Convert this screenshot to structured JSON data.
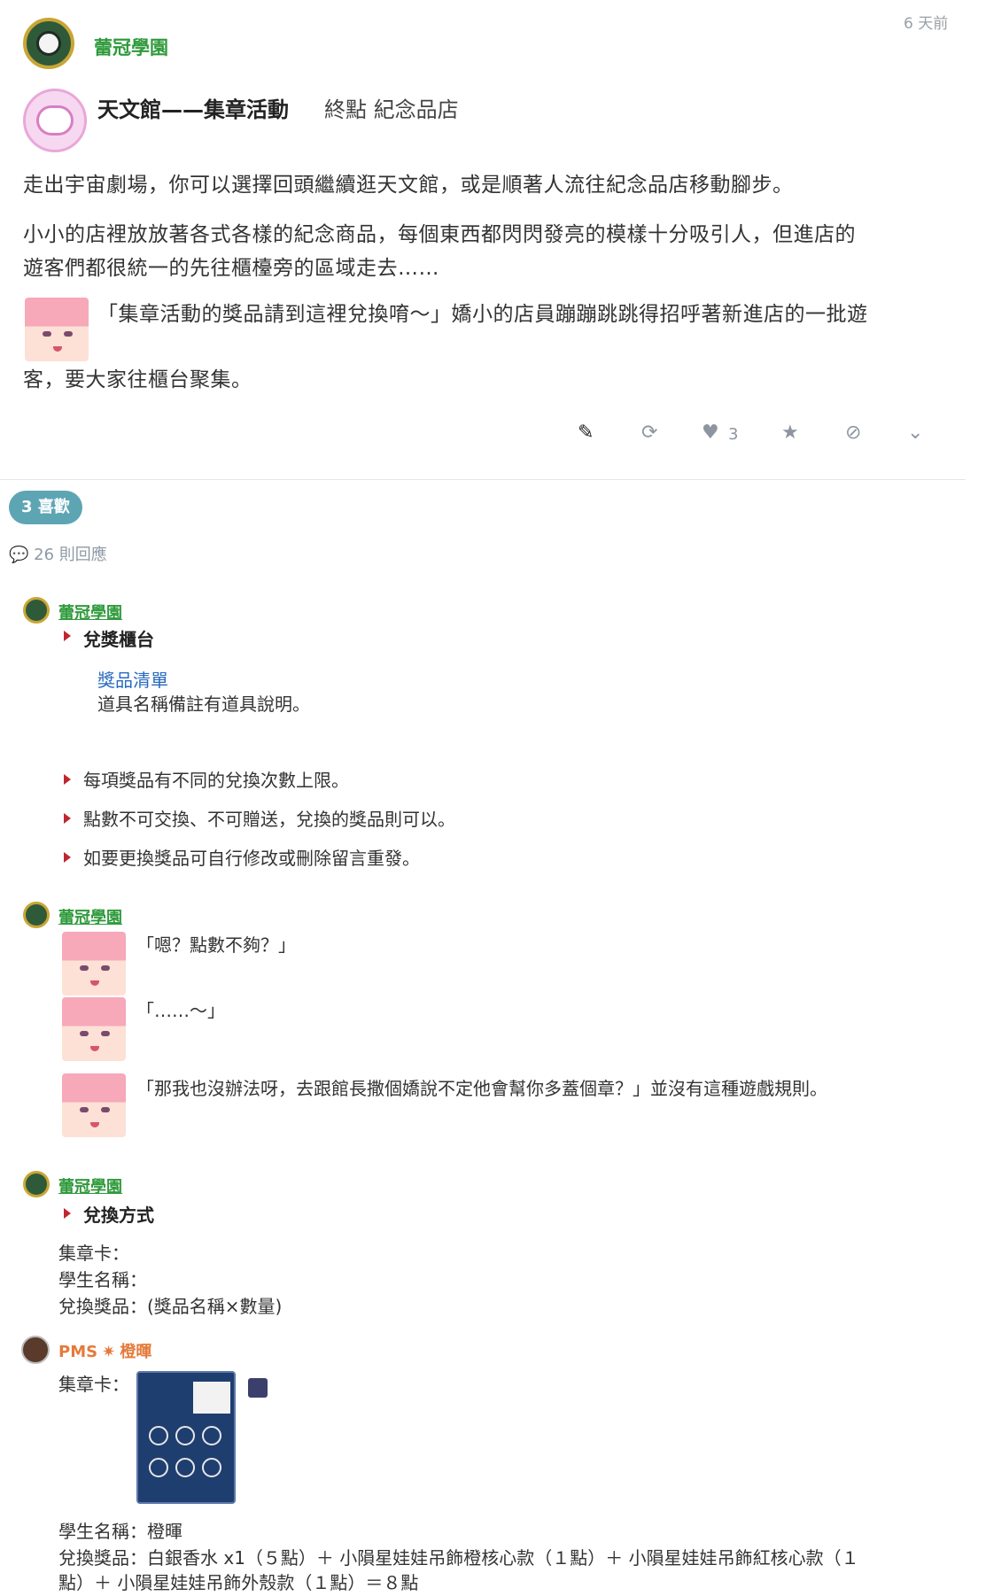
{
  "post": {
    "author": "蕾冠學園",
    "time": "6 天前",
    "title_main": "天文館——集章活動",
    "title_sub": "終點 紀念品店",
    "p1": "走出宇宙劇場，你可以選擇回頭繼續逛天文館，或是順著人流往紀念品店移動腳步。",
    "p2_line1": "小小的店裡放放著各式各樣的紀念商品，每個東西都閃閃發亮的模樣十分吸引人，但進店的",
    "p2_line2": "遊客們都很統一的先往櫃檯旁的區域走去……",
    "p3_line1": "「集章活動的獎品請到這裡兌換唷～」嬌小的店員蹦蹦跳跳得招呼著新進店的一批遊",
    "p3_line2": "客，要大家往櫃台聚集。"
  },
  "actions": {
    "like_count": "3",
    "icons": [
      "mute-icon",
      "refresh-icon",
      "heart-icon",
      "star-icon",
      "flag-icon",
      "chevron-down-icon"
    ]
  },
  "summary": {
    "likes_pill": "3 喜歡",
    "replies": "26 則回應"
  },
  "quote1": {
    "author": "蕾冠學園",
    "section_title": "兌獎櫃台",
    "link": "獎品清單",
    "note": "道具名稱備註有道具說明。",
    "bullets": [
      "每項獎品有不同的兌換次數上限。",
      "點數不可交換、不可贈送，兌換的獎品則可以。",
      "如要更換獎品可自行修改或刪除留言重發。"
    ]
  },
  "quote2": {
    "author": "蕾冠學園",
    "line1": "「嗯？點數不夠？」",
    "line2": "「……～」",
    "line3": "「那我也沒辦法呀，去跟館長撒個嬌說不定他會幫你多蓋個章？」並沒有這種遊戲規則。"
  },
  "quote3": {
    "author": "蕾冠學園",
    "section_title": "兌換方式",
    "l1": "集章卡：",
    "l2": "學生名稱：",
    "l3": "兌換獎品：(獎品名稱×數量)"
  },
  "reply": {
    "author": "PMS",
    "star": "✷",
    "name": "橙暉",
    "card_label": "集章卡：",
    "student": "學生名稱：橙暉",
    "prize_line1": "兌換獎品：白銀香水 x1（５點）＋ 小隕星娃娃吊飾橙核心款（１點）＋ 小隕星娃娃吊飾紅核心款（１",
    "prize_line2": "點）＋ 小隕星娃娃吊飾外殼款（１點）＝８點"
  },
  "colors": {
    "accent_green": "#2f9a3c",
    "likes_pill": "#5ea5b4",
    "bullet_red": "#c02631",
    "link_blue": "#2a6bbf",
    "pms_orange": "#e47a3a"
  }
}
